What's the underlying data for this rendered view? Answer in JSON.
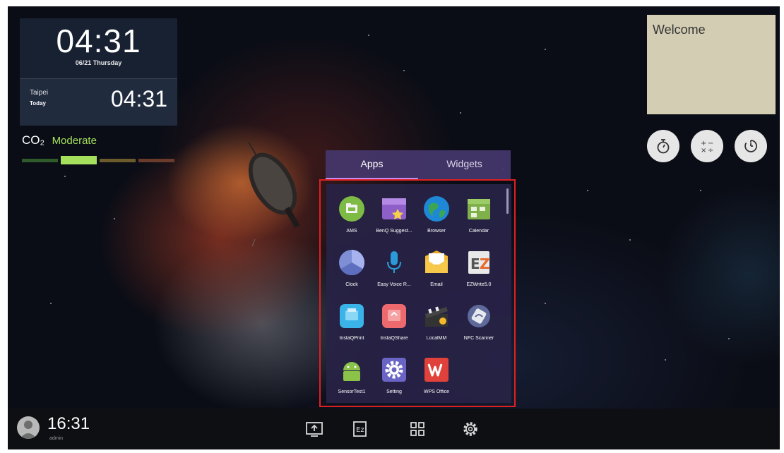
{
  "clock": {
    "time": "04:31",
    "date": "06/21 Thursday",
    "city": "Taipei",
    "day": "Today",
    "city_time": "04:31"
  },
  "co2": {
    "label": "CO₂",
    "status": "Moderate",
    "colors": [
      "#2f5a2c",
      "#a4e05b",
      "#6b5a2b",
      "#6a3a2a"
    ]
  },
  "note": {
    "text": "Welcome"
  },
  "tools": [
    {
      "name": "stopwatch-icon"
    },
    {
      "name": "calculator-icon"
    },
    {
      "name": "timer-icon"
    }
  ],
  "drawer": {
    "tabs": [
      "Apps",
      "Widgets"
    ],
    "active_tab": "Apps",
    "apps": [
      {
        "label": "AMS",
        "icon": "ams-icon"
      },
      {
        "label": "BenQ Suggest...",
        "icon": "benq-suggest-icon"
      },
      {
        "label": "Browser",
        "icon": "browser-icon"
      },
      {
        "label": "Calendar",
        "icon": "calendar-icon"
      },
      {
        "label": "Clock",
        "icon": "clock-icon"
      },
      {
        "label": "Easy Voice R...",
        "icon": "microphone-icon"
      },
      {
        "label": "Email",
        "icon": "email-icon"
      },
      {
        "label": "EZWrite5.0",
        "icon": "ezwrite-icon"
      },
      {
        "label": "InstaQPrint",
        "icon": "instaqprint-icon"
      },
      {
        "label": "InstaQShare",
        "icon": "instaqshare-icon"
      },
      {
        "label": "LocalMM",
        "icon": "localmm-icon"
      },
      {
        "label": "NFC Scanner",
        "icon": "nfc-scanner-icon"
      },
      {
        "label": "SensorTest1",
        "icon": "android-icon"
      },
      {
        "label": "Setting",
        "icon": "settings-icon"
      },
      {
        "label": "WPS Office",
        "icon": "wps-office-icon"
      }
    ]
  },
  "taskbar": {
    "time": "16:31",
    "user": "admin",
    "buttons": [
      "input-source-icon",
      "ezwrite-icon",
      "apps-grid-icon",
      "settings-gear-icon"
    ]
  }
}
